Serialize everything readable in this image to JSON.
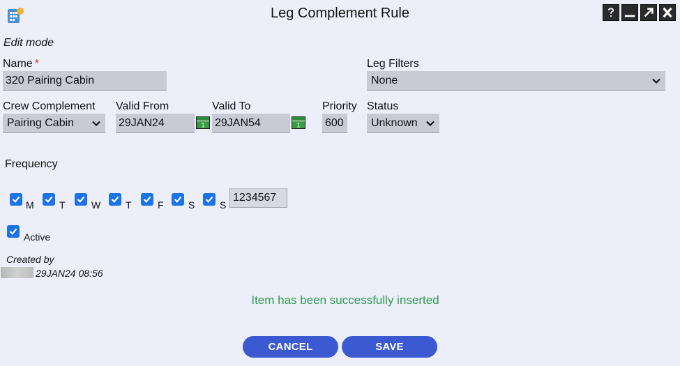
{
  "window": {
    "title": "Leg Complement Rule",
    "mode": "Edit mode"
  },
  "form": {
    "name": {
      "label": "Name",
      "required_mark": "*",
      "value": "320 Pairing Cabin"
    },
    "leg_filters": {
      "label": "Leg Filters",
      "value": "None"
    },
    "crew_complement": {
      "label": "Crew Complement",
      "value": "Pairing Cabin"
    },
    "valid_from": {
      "label": "Valid From",
      "value": "29JAN24"
    },
    "valid_to": {
      "label": "Valid To",
      "value": "29JAN54"
    },
    "priority": {
      "label": "Priority",
      "value": "600"
    },
    "status": {
      "label": "Status",
      "value": "Unknown"
    },
    "frequency": {
      "label": "Frequency",
      "days": [
        {
          "label": "M",
          "checked": true
        },
        {
          "label": "T",
          "checked": true
        },
        {
          "label": "W",
          "checked": true
        },
        {
          "label": "T",
          "checked": true
        },
        {
          "label": "F",
          "checked": true
        },
        {
          "label": "S",
          "checked": true
        },
        {
          "label": "S",
          "checked": true
        }
      ],
      "value": "1234567"
    },
    "active": {
      "label": "Active",
      "checked": true
    }
  },
  "created": {
    "label": "Created by",
    "timestamp": "29JAN24 08:56"
  },
  "message": "Item has been successfully inserted",
  "buttons": {
    "cancel": "CANCEL",
    "save": "SAVE"
  },
  "colors": {
    "background": "#eceef9",
    "field": "#c8cbd6",
    "checkbox": "#1a73e8",
    "button": "#3b59d0",
    "success": "#2e9b4f",
    "required": "#d62828"
  },
  "icons": {
    "app": "app-grid-icon",
    "help": "help-icon",
    "minimize": "minimize-icon",
    "maximize": "maximize-icon",
    "close": "close-icon",
    "calendar": "calendar-icon",
    "dropdown": "chevron-down-icon"
  }
}
